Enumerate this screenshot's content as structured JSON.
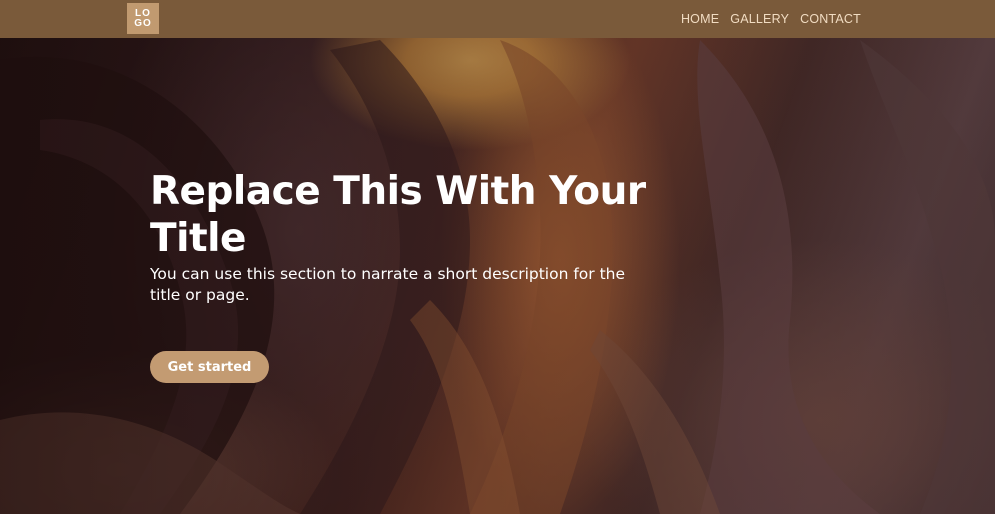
{
  "navbar": {
    "logo_line1": "LO",
    "logo_line2": "GO",
    "links": [
      {
        "label": "HOME"
      },
      {
        "label": "GALLERY"
      },
      {
        "label": "CONTACT"
      }
    ]
  },
  "hero": {
    "title": "Replace This With Your Title",
    "description": "You can use this section to narrate a short description for the title or page.",
    "cta_label": "Get started"
  },
  "colors": {
    "navbar_bg": "#7a5a3a",
    "logo_bg": "#c19a70",
    "nav_text": "#f1dcc2",
    "button_bg": "#c39b72",
    "text": "#ffffff"
  }
}
